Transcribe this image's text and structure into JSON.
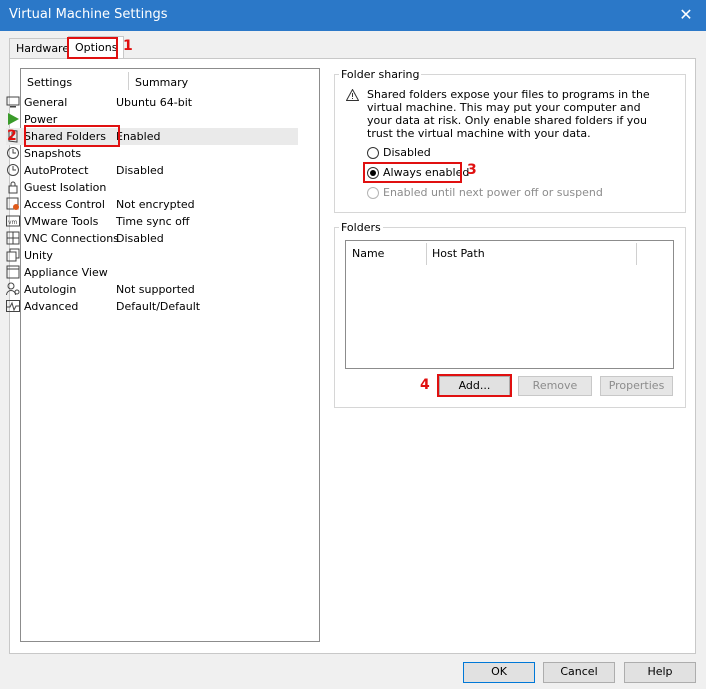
{
  "window": {
    "title": "Virtual Machine Settings",
    "close_glyph": "✕"
  },
  "tabs": [
    {
      "label": "Hardware"
    },
    {
      "label": "Options"
    }
  ],
  "list": {
    "header_settings": "Settings",
    "header_summary": "Summary",
    "items": [
      {
        "label": "General",
        "summary": "Ubuntu 64-bit",
        "icon": "monitor-icon"
      },
      {
        "label": "Power",
        "summary": "",
        "icon": "play-icon"
      },
      {
        "label": "Shared Folders",
        "summary": "Enabled",
        "icon": "folder-icon"
      },
      {
        "label": "Snapshots",
        "summary": "",
        "icon": "clock-icon"
      },
      {
        "label": "AutoProtect",
        "summary": "Disabled",
        "icon": "clock-icon"
      },
      {
        "label": "Guest Isolation",
        "summary": "",
        "icon": "lock-icon"
      },
      {
        "label": "Access Control",
        "summary": "Not encrypted",
        "icon": "padlock-icon"
      },
      {
        "label": "VMware Tools",
        "summary": "Time sync off",
        "icon": "vm-icon"
      },
      {
        "label": "VNC Connections",
        "summary": "Disabled",
        "icon": "network-icon"
      },
      {
        "label": "Unity",
        "summary": "",
        "icon": "window-icon"
      },
      {
        "label": "Appliance View",
        "summary": "",
        "icon": "window-icon"
      },
      {
        "label": "Autologin",
        "summary": "Not supported",
        "icon": "user-icon"
      },
      {
        "label": "Advanced",
        "summary": "Default/Default",
        "icon": "pulse-icon"
      }
    ]
  },
  "folder_sharing": {
    "title": "Folder sharing",
    "warning_lines": [
      "Shared folders expose your files to programs in the",
      "virtual machine. This may put your computer and",
      "your data at risk. Only enable shared folders if you",
      "trust the virtual machine with your data."
    ],
    "options": [
      {
        "label": "Disabled",
        "selected": false,
        "enabled": true
      },
      {
        "label": "Always enabled",
        "selected": true,
        "enabled": true
      },
      {
        "label": "Enabled until next power off or suspend",
        "selected": false,
        "enabled": false
      }
    ]
  },
  "folders": {
    "title": "Folders",
    "columns": [
      "Name",
      "Host Path"
    ],
    "add_label": "Add...",
    "remove_label": "Remove",
    "properties_label": "Properties"
  },
  "footer": {
    "ok_label": "OK",
    "cancel_label": "Cancel",
    "help_label": "Help"
  },
  "annotations": [
    "1",
    "2",
    "3",
    "4"
  ],
  "colors": {
    "titlebar": "#2b78c8",
    "annotation": "#e01010",
    "selection": "#eaeaea"
  }
}
